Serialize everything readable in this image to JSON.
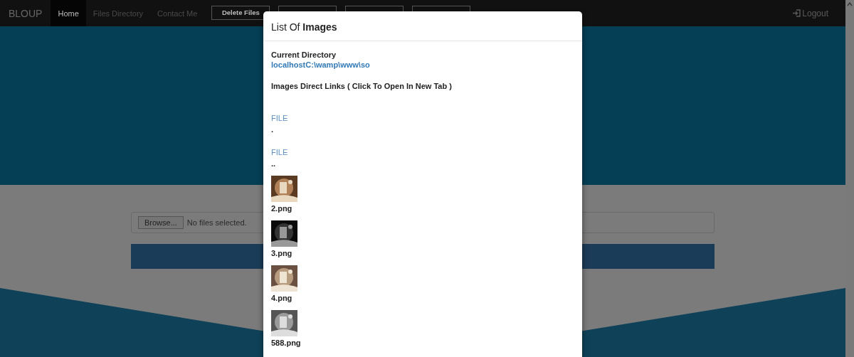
{
  "navbar": {
    "brand": "BLOUP",
    "links": [
      {
        "label": "Home",
        "selected": true
      },
      {
        "label": "Files Directory",
        "selected": false
      },
      {
        "label": "Contact Me",
        "selected": false
      }
    ],
    "buttons": [
      {
        "kind": "text",
        "label": "Delete Files"
      },
      {
        "kind": "covered"
      },
      {
        "kind": "covered"
      },
      {
        "kind": "covered"
      }
    ],
    "logout": "Logout"
  },
  "upload": {
    "browse_button": "Browse...",
    "status": "No files selected."
  },
  "modal": {
    "title": "List Of **Images**",
    "directory_label": "Current Directory",
    "directory": "localhostC:\\wamp\\www\\so",
    "links_heading": "Images Direct Links ( Click To Open In New Tab )",
    "entries": [
      {
        "kind": "file",
        "type_label": "FILE",
        "name": "."
      },
      {
        "kind": "file",
        "type_label": "FILE",
        "name": ".."
      },
      {
        "name": "2.png"
      },
      {
        "name": "3.png"
      },
      {
        "name": "4.png"
      },
      {
        "name": "588.png"
      }
    ]
  }
}
